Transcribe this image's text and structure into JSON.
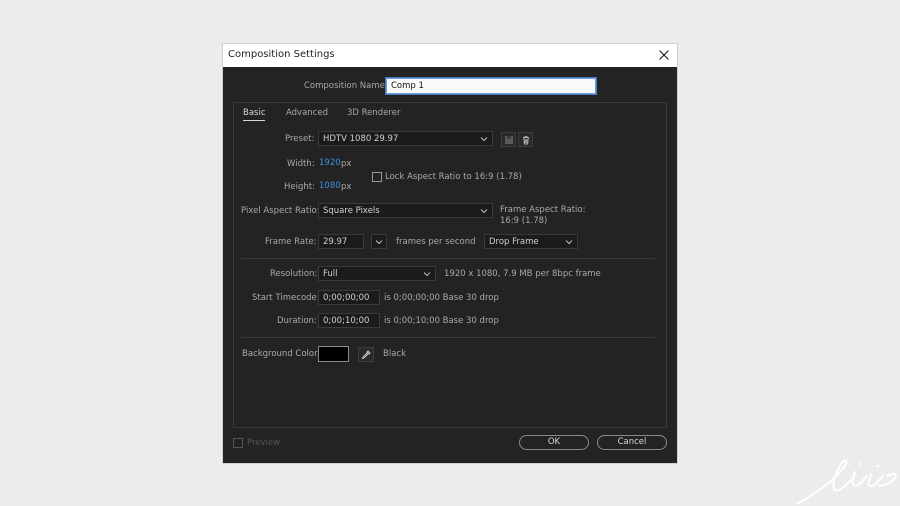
{
  "dialog": {
    "title": "Composition Settings",
    "comp_name_label": "Composition Name:",
    "comp_name_value": "Comp 1"
  },
  "tabs": [
    {
      "label": "Basic",
      "active": true
    },
    {
      "label": "Advanced",
      "active": false
    },
    {
      "label": "3D Renderer",
      "active": false
    }
  ],
  "basic": {
    "preset_label": "Preset:",
    "preset_value": "HDTV 1080 29.97",
    "width_label": "Width:",
    "width_value": "1920",
    "width_unit": "px",
    "height_label": "Height:",
    "height_value": "1080",
    "height_unit": "px",
    "lock_aspect_label": "Lock Aspect Ratio to 16:9 (1.78)",
    "lock_aspect_checked": false,
    "par_label": "Pixel Aspect Ratio:",
    "par_value": "Square Pixels",
    "frame_aspect_label": "Frame Aspect Ratio:",
    "frame_aspect_value": "16:9 (1.78)",
    "frame_rate_label": "Frame Rate:",
    "frame_rate_value": "29.97",
    "frame_rate_unit": "frames per second",
    "drop_frame_value": "Drop Frame",
    "resolution_label": "Resolution:",
    "resolution_value": "Full",
    "resolution_info": "1920 x 1080, 7.9 MB per 8bpc frame",
    "start_tc_label": "Start Timecode:",
    "start_tc_value": "0;00;00;00",
    "start_tc_info": "is 0;00;00;00  Base 30  drop",
    "duration_label": "Duration:",
    "duration_value": "0;00;10;00",
    "duration_info": "is 0;00;10;00  Base 30  drop",
    "bg_color_label": "Background Color:",
    "bg_color_value": "#000000",
    "bg_color_name": "Black"
  },
  "footer": {
    "preview_label": "Preview",
    "ok_label": "OK",
    "cancel_label": "Cancel"
  },
  "colors": {
    "accent": "#3f8fe0",
    "background": "#232323"
  },
  "icons": {
    "close": "close-icon",
    "save_preset": "save-preset-icon",
    "delete_preset": "trash-icon",
    "eyedropper": "eyedropper-icon",
    "chevron": "chevron-down-icon"
  }
}
